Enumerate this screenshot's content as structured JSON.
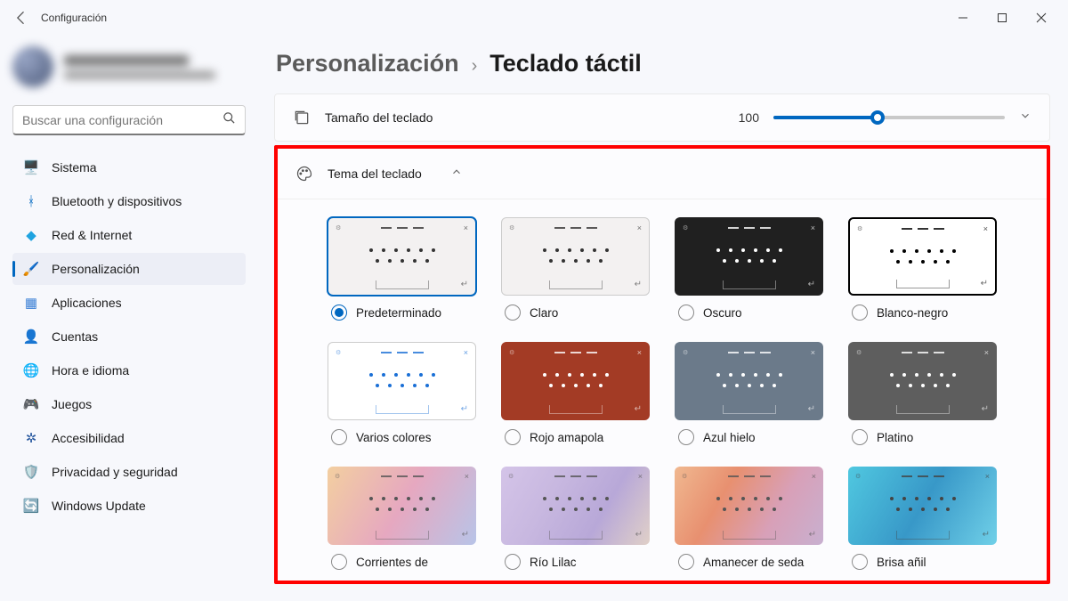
{
  "window": {
    "title": "Configuración"
  },
  "search": {
    "placeholder": "Buscar una configuración"
  },
  "nav": {
    "items": [
      {
        "icon": "🖥️",
        "label": "Sistema"
      },
      {
        "icon": "ᚼ",
        "label": "Bluetooth y dispositivos",
        "iconColor": "#0067c0"
      },
      {
        "icon": "◆",
        "label": "Red & Internet",
        "iconColor": "#1fa3e0"
      },
      {
        "icon": "🖌️",
        "label": "Personalización"
      },
      {
        "icon": "▦",
        "label": "Aplicaciones",
        "iconColor": "#3a7fd5"
      },
      {
        "icon": "👤",
        "label": "Cuentas",
        "iconColor": "#e09a3a"
      },
      {
        "icon": "🌐",
        "label": "Hora e idioma",
        "iconColor": "#3aa0d5"
      },
      {
        "icon": "🎮",
        "label": "Juegos",
        "iconColor": "#777"
      },
      {
        "icon": "✲",
        "label": "Accesibilidad",
        "iconColor": "#2a5aa0"
      },
      {
        "icon": "🛡️",
        "label": "Privacidad y seguridad",
        "iconColor": "#888"
      },
      {
        "icon": "🔄",
        "label": "Windows Update",
        "iconColor": "#0aa0d0"
      }
    ],
    "activeIndex": 3
  },
  "breadcrumb": {
    "parent": "Personalización",
    "current": "Teclado táctil"
  },
  "size": {
    "label": "Tamaño del teclado",
    "value": "100"
  },
  "themeSection": {
    "label": "Tema del teclado"
  },
  "themes": [
    {
      "label": "Predeterminado",
      "cls": "light",
      "selected": true
    },
    {
      "label": "Claro",
      "cls": "light"
    },
    {
      "label": "Oscuro",
      "cls": "dark"
    },
    {
      "label": "Blanco-negro",
      "cls": "bw"
    },
    {
      "label": "Varios colores",
      "cls": "multi"
    },
    {
      "label": "Rojo amapola",
      "cls": "poppy"
    },
    {
      "label": "Azul hielo",
      "cls": "ice"
    },
    {
      "label": "Platino",
      "cls": "plat"
    },
    {
      "label": "Corrientes de",
      "cls": "grad1"
    },
    {
      "label": "Río Lilac",
      "cls": "grad2"
    },
    {
      "label": "Amanecer de seda",
      "cls": "grad3"
    },
    {
      "label": "Brisa añil",
      "cls": "grad4"
    }
  ]
}
